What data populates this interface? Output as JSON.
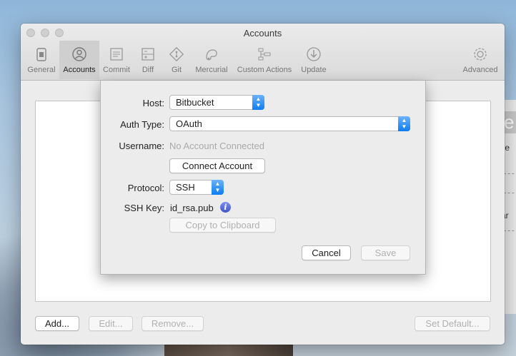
{
  "window": {
    "title": "Accounts"
  },
  "toolbar": {
    "items": [
      {
        "label": "General",
        "icon": "general-icon"
      },
      {
        "label": "Accounts",
        "icon": "accounts-icon",
        "selected": true
      },
      {
        "label": "Commit",
        "icon": "commit-icon"
      },
      {
        "label": "Diff",
        "icon": "diff-icon"
      },
      {
        "label": "Git",
        "icon": "git-icon"
      },
      {
        "label": "Mercurial",
        "icon": "mercurial-icon"
      },
      {
        "label": "Custom Actions",
        "icon": "custom-actions-icon"
      },
      {
        "label": "Update",
        "icon": "update-icon"
      },
      {
        "label": "Advanced",
        "icon": "advanced-icon"
      }
    ]
  },
  "footer": {
    "add_label": "Add...",
    "edit_label": "Edit...",
    "remove_label": "Remove...",
    "set_default_label": "Set Default..."
  },
  "sheet": {
    "host_label": "Host:",
    "host_value": "Bitbucket",
    "auth_label": "Auth Type:",
    "auth_value": "OAuth",
    "username_label": "Username:",
    "username_placeholder": "No Account Connected",
    "connect_label": "Connect Account",
    "protocol_label": "Protocol:",
    "protocol_value": "SSH",
    "ssh_key_label": "SSH Key:",
    "ssh_key_value": "id_rsa.pub",
    "info_glyph": "i",
    "copy_label": "Copy to Clipboard",
    "cancel_label": "Cancel",
    "save_label": "Save"
  },
  "background_window": {
    "big_glyph": "e",
    "fragments": [
      "r re",
      "car"
    ]
  },
  "colors": {
    "accent": "#0d7cf2",
    "info": "#4055c9"
  }
}
